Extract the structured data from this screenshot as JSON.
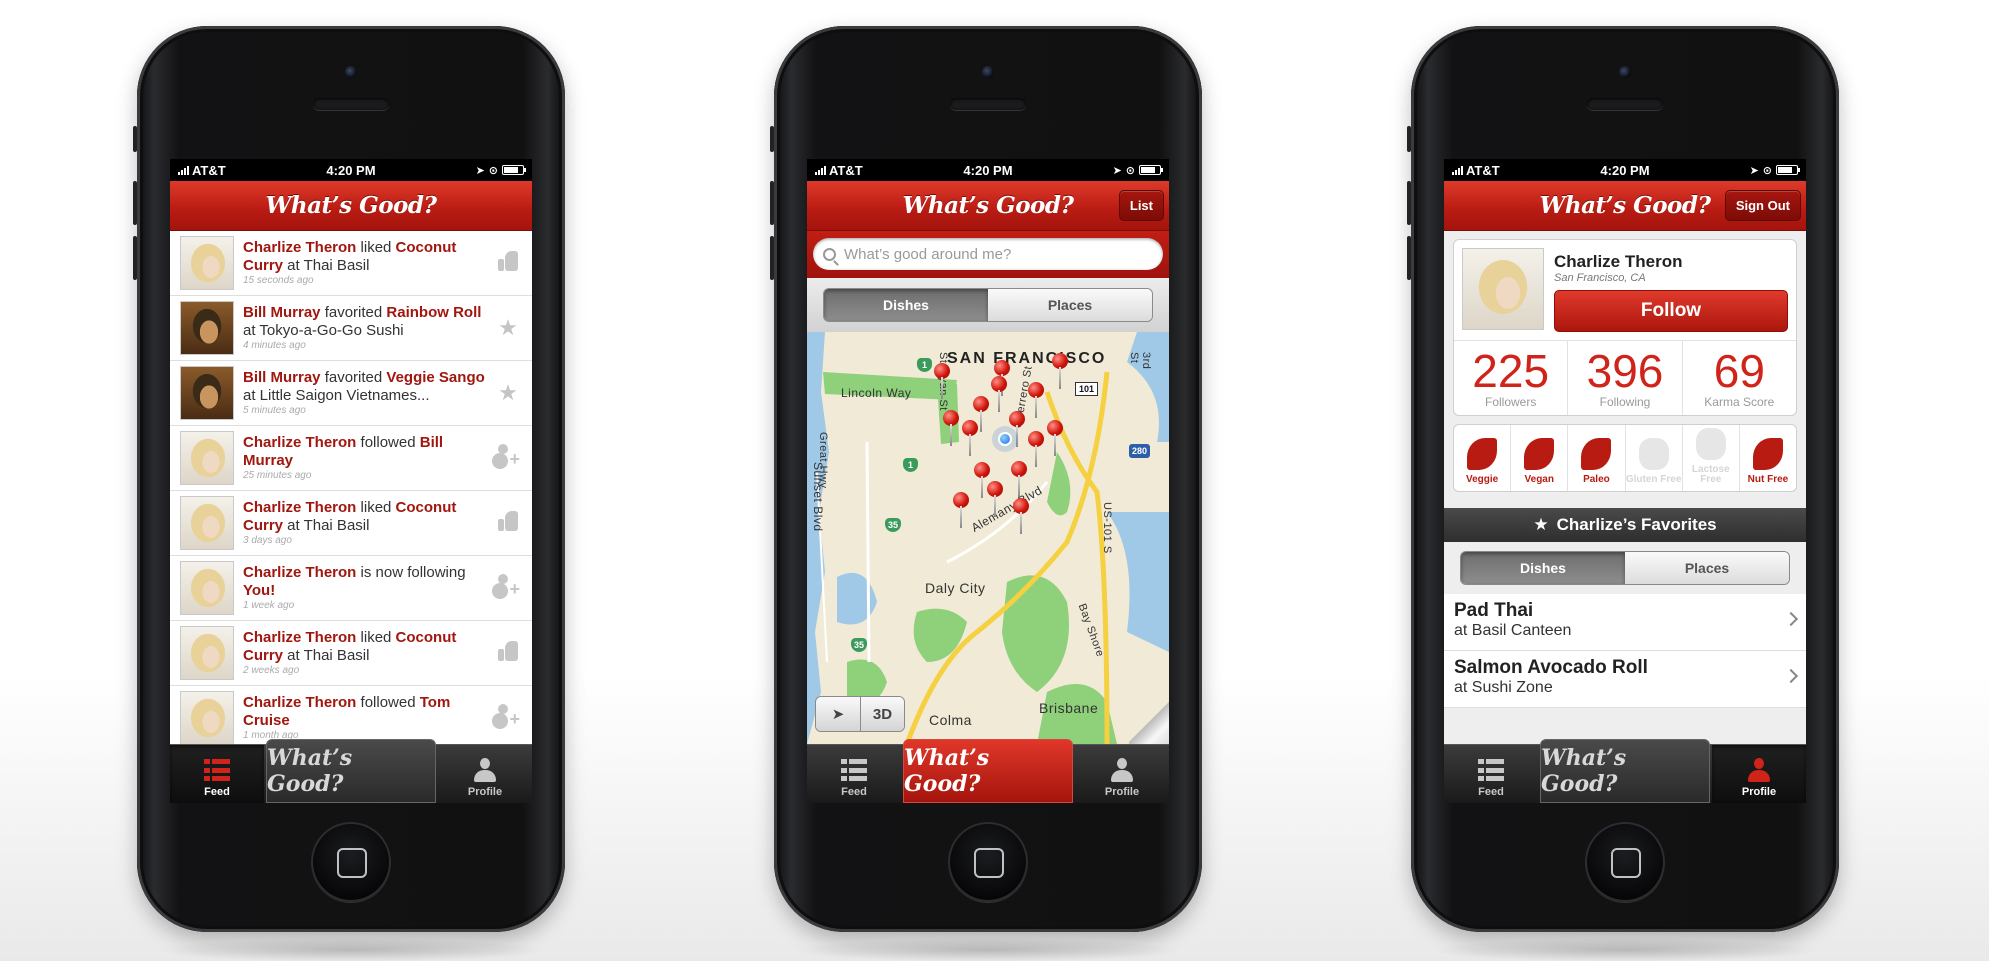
{
  "status": {
    "carrier": "AT&T",
    "time": "4:20 PM"
  },
  "app": {
    "logo": "What’s Good?"
  },
  "feed": [
    {
      "actor": "Charlize Theron",
      "verb": " liked ",
      "object": "Coconut Curry",
      "rest": " at Thai Basil",
      "time": "15 seconds ago",
      "action_icon": "thumbs-up-icon",
      "avatar": "blonde"
    },
    {
      "actor": "Bill Murray",
      "verb": " favorited ",
      "object": "Rainbow Roll",
      "rest": " at Tokyo-a-Go-Go Sushi",
      "time": "4 minutes ago",
      "action_icon": "star-icon",
      "avatar": "bill"
    },
    {
      "actor": "Bill Murray",
      "verb": " favorited ",
      "object": "Veggie Sango",
      "rest": " at Little Saigon Vietnames...",
      "time": "5 minutes ago",
      "action_icon": "star-icon",
      "avatar": "bill"
    },
    {
      "actor": "Charlize Theron",
      "verb": " followed ",
      "object": "Bill Murray",
      "rest": "",
      "time": "25 minutes ago",
      "action_icon": "add-person-icon",
      "avatar": "blonde"
    },
    {
      "actor": "Charlize Theron",
      "verb": " liked ",
      "object": "Coconut Curry",
      "rest": " at Thai Basil",
      "time": "3 days ago",
      "action_icon": "thumbs-up-icon",
      "avatar": "blonde"
    },
    {
      "actor": "Charlize Theron",
      "verb": " is now following ",
      "object": "You!",
      "rest": "",
      "time": "1 week ago",
      "action_icon": "add-person-icon",
      "avatar": "blonde"
    },
    {
      "actor": "Charlize Theron",
      "verb": " liked ",
      "object": "Coconut Curry",
      "rest": " at Thai Basil",
      "time": "2 weeks ago",
      "action_icon": "thumbs-up-icon",
      "avatar": "blonde"
    },
    {
      "actor": "Charlize Theron",
      "verb": " followed ",
      "object": "Tom Cruise",
      "rest": "",
      "time": "1 month ago",
      "action_icon": "add-person-icon",
      "avatar": "blonde"
    }
  ],
  "tabs": {
    "feed": "Feed",
    "center": "What’s Good?",
    "profile": "Profile"
  },
  "map_screen": {
    "nav_button": "List",
    "search_placeholder": "What’s good around me?",
    "segments": [
      "Dishes",
      "Places"
    ],
    "labels": {
      "city": "SAN FRANCISCO",
      "daly": "Daly City",
      "brisbane": "Brisbane",
      "colma": "Colma",
      "lincoln": "Lincoln Way",
      "sunset": "Sunset Blvd",
      "great": "Great Hwy",
      "alemany": "Alemany Blvd",
      "bayshore": "Bay Shore",
      "stanyan": "Stanyan St",
      "guerrero": "Guerrero St",
      "third": "3rd St",
      "us101": "US-101 S"
    },
    "shields": {
      "a": "1",
      "b": "1",
      "c": "35",
      "d": "35",
      "e": "101",
      "f": "280"
    },
    "controls": {
      "locate": "➤",
      "threeD": "3D"
    }
  },
  "profile_screen": {
    "nav_button": "Sign Out",
    "name": "Charlize Theron",
    "location": "San Francisco, CA",
    "follow": "Follow",
    "stats": [
      {
        "value": "225",
        "label": "Followers"
      },
      {
        "value": "396",
        "label": "Following"
      },
      {
        "value": "69",
        "label": "Karma Score"
      }
    ],
    "diets": [
      {
        "label": "Veggie",
        "active": true
      },
      {
        "label": "Vegan",
        "active": true
      },
      {
        "label": "Paleo",
        "active": true
      },
      {
        "label": "Gluten Free",
        "active": false
      },
      {
        "label": "Lactose Free",
        "active": false
      },
      {
        "label": "Nut Free",
        "active": true
      }
    ],
    "favorites_title": "Charlize’s Favorites",
    "segments": [
      "Dishes",
      "Places"
    ],
    "favorites": [
      {
        "title": "Pad Thai",
        "subtitle": "at Basil Canteen"
      },
      {
        "title": "Salmon Avocado Roll",
        "subtitle": "at Sushi Zone"
      }
    ]
  },
  "colors": {
    "brand_red": "#c21e14",
    "highlight_red": "#a1170f",
    "tab_dark": "#1a1a1a"
  }
}
